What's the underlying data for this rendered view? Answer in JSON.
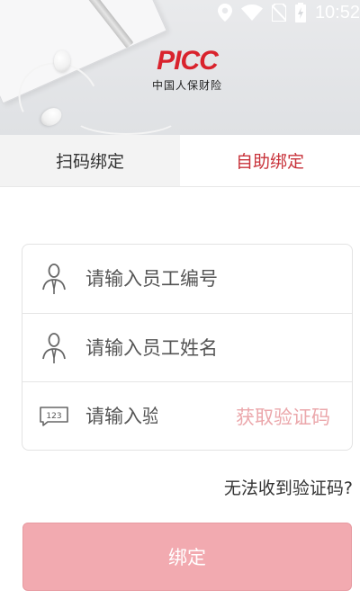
{
  "status_bar": {
    "time": "10:52",
    "icons": [
      "location-icon",
      "wifi-icon",
      "no-sim-icon",
      "battery-charging-icon"
    ]
  },
  "header": {
    "logo_text": "PICC",
    "logo_subtitle": "中国人保财险"
  },
  "tabs": [
    {
      "label": "扫码绑定",
      "active": false
    },
    {
      "label": "自助绑定",
      "active": true
    }
  ],
  "form": {
    "employee_id_placeholder": "请输入员工编号",
    "employee_name_placeholder": "请输入员工姓名",
    "code_placeholder": "请输入验证码",
    "get_code_label": "获取验证码",
    "icons": [
      "person-icon",
      "person-icon",
      "sms-code-icon"
    ]
  },
  "help_link": "无法收到验证码?",
  "submit_label": "绑定",
  "colors": {
    "brand_red": "#d9232d",
    "active_tab": "#c8323a",
    "button_disabled": "#f2aab0"
  }
}
